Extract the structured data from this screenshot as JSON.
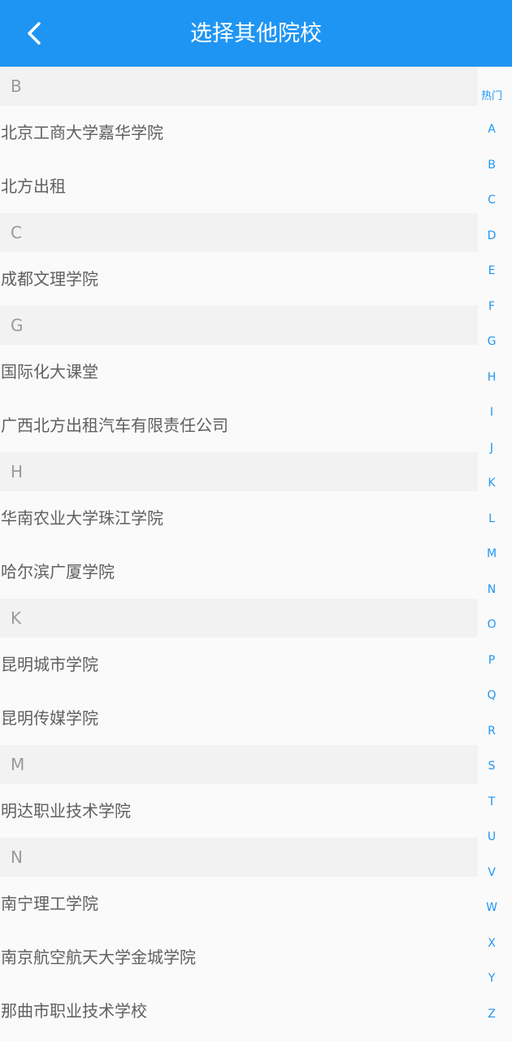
{
  "header": {
    "title": "选择其他院校",
    "back_icon": "chevron-left-icon",
    "background_color": "#1f95f3"
  },
  "list": [
    {
      "type": "section",
      "label": "B"
    },
    {
      "type": "item",
      "label": "北京工商大学嘉华学院"
    },
    {
      "type": "item",
      "label": "北方出租"
    },
    {
      "type": "section",
      "label": "C"
    },
    {
      "type": "item",
      "label": "成都文理学院"
    },
    {
      "type": "section",
      "label": "G"
    },
    {
      "type": "item",
      "label": "国际化大课堂"
    },
    {
      "type": "item",
      "label": "广西北方出租汽车有限责任公司"
    },
    {
      "type": "section",
      "label": "H"
    },
    {
      "type": "item",
      "label": "华南农业大学珠江学院"
    },
    {
      "type": "item",
      "label": "哈尔滨广厦学院"
    },
    {
      "type": "section",
      "label": "K"
    },
    {
      "type": "item",
      "label": "昆明城市学院"
    },
    {
      "type": "item",
      "label": "昆明传媒学院"
    },
    {
      "type": "section",
      "label": "M"
    },
    {
      "type": "item",
      "label": "明达职业技术学院"
    },
    {
      "type": "section",
      "label": "N"
    },
    {
      "type": "item",
      "label": "南宁理工学院"
    },
    {
      "type": "item",
      "label": "南京航空航天大学金城学院"
    },
    {
      "type": "item",
      "label": "那曲市职业技术学校"
    }
  ],
  "index_bar": {
    "hot_label": "热门",
    "letters": [
      "A",
      "B",
      "C",
      "D",
      "E",
      "F",
      "G",
      "H",
      "I",
      "J",
      "K",
      "L",
      "M",
      "N",
      "O",
      "P",
      "Q",
      "R",
      "S",
      "T",
      "U",
      "V",
      "W",
      "X",
      "Y",
      "Z"
    ],
    "color": "#1f95f3"
  }
}
